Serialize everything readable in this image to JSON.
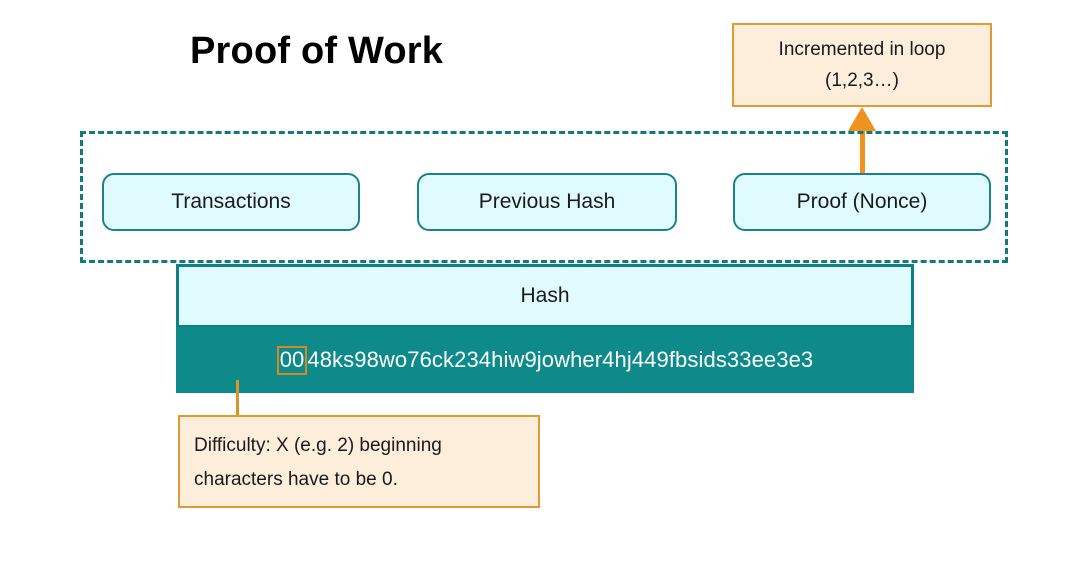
{
  "title": "Proof of Work",
  "callouts": {
    "nonce_note": {
      "line1": "Incremented in loop",
      "line2": "(1,2,3…)"
    },
    "difficulty_note": {
      "line1": "Difficulty: X (e.g. 2) beginning",
      "line2": "characters have to be 0."
    }
  },
  "block": {
    "fields": [
      {
        "label": "Transactions"
      },
      {
        "label": "Previous Hash"
      },
      {
        "label": "Proof (Nonce)"
      }
    ]
  },
  "hash_table": {
    "header": "Hash",
    "value_prefix": "00",
    "value_rest": "48ks98wo76ck234hiw9jowher4hj449fbsids33ee3e3",
    "full_value": "0048ks98wo76ck234hiw9jowher4hj449fbsids33ee3e3"
  },
  "colors": {
    "teal_dark": "#0e8a8a",
    "teal_border": "#0f7f85",
    "cyan_fill": "#e0fbfd",
    "orange_border": "#e39a31",
    "cream_fill": "#fdeedc",
    "arrow_orange": "#f0921e",
    "highlight_gold": "#d08a28"
  }
}
